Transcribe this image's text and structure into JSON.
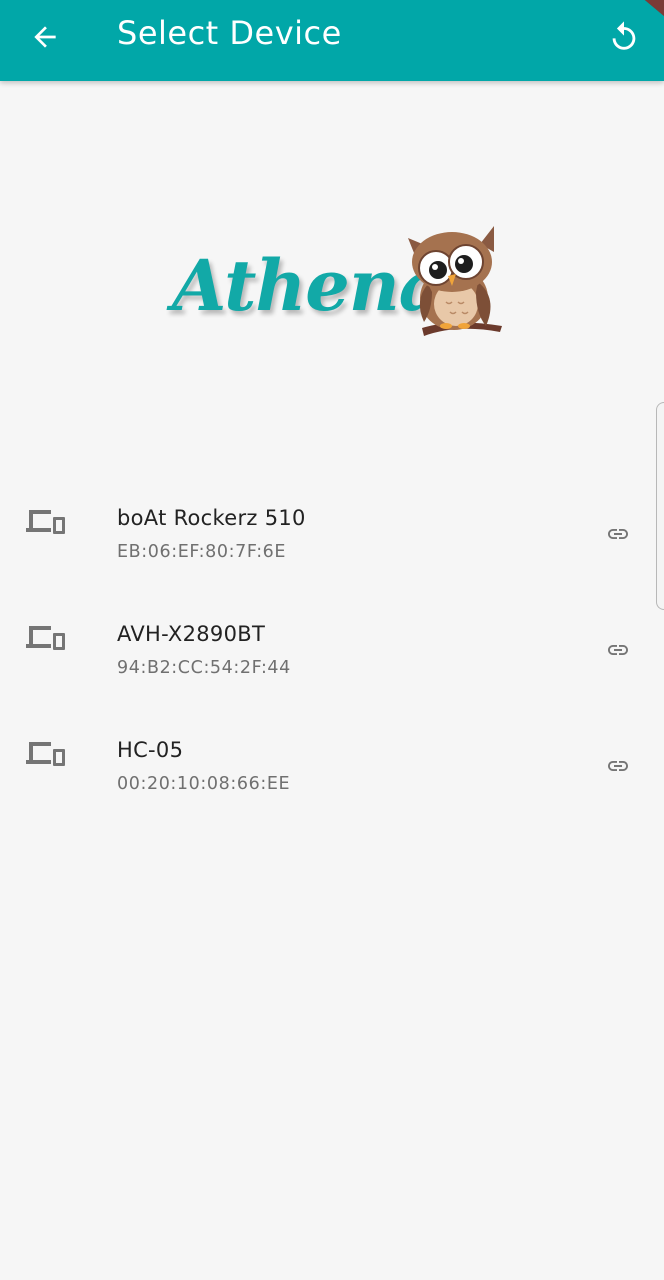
{
  "app_bar": {
    "title": "Select Device",
    "back_icon": "arrow-back-icon",
    "refresh_icon": "refresh-icon",
    "background": "#01a7a8"
  },
  "logo": {
    "text": "Athena",
    "icon": "owl-mascot",
    "color": "#12a9a7"
  },
  "devices": [
    {
      "name": "boAt Rockerz 510",
      "address": "EB:06:EF:80:7F:6E",
      "icon": "devices-icon",
      "action_icon": "link-icon"
    },
    {
      "name": "AVH-X2890BT",
      "address": "94:B2:CC:54:2F:44",
      "icon": "devices-icon",
      "action_icon": "link-icon"
    },
    {
      "name": "HC-05",
      "address": "00:20:10:08:66:EE",
      "icon": "devices-icon",
      "action_icon": "link-icon"
    }
  ]
}
